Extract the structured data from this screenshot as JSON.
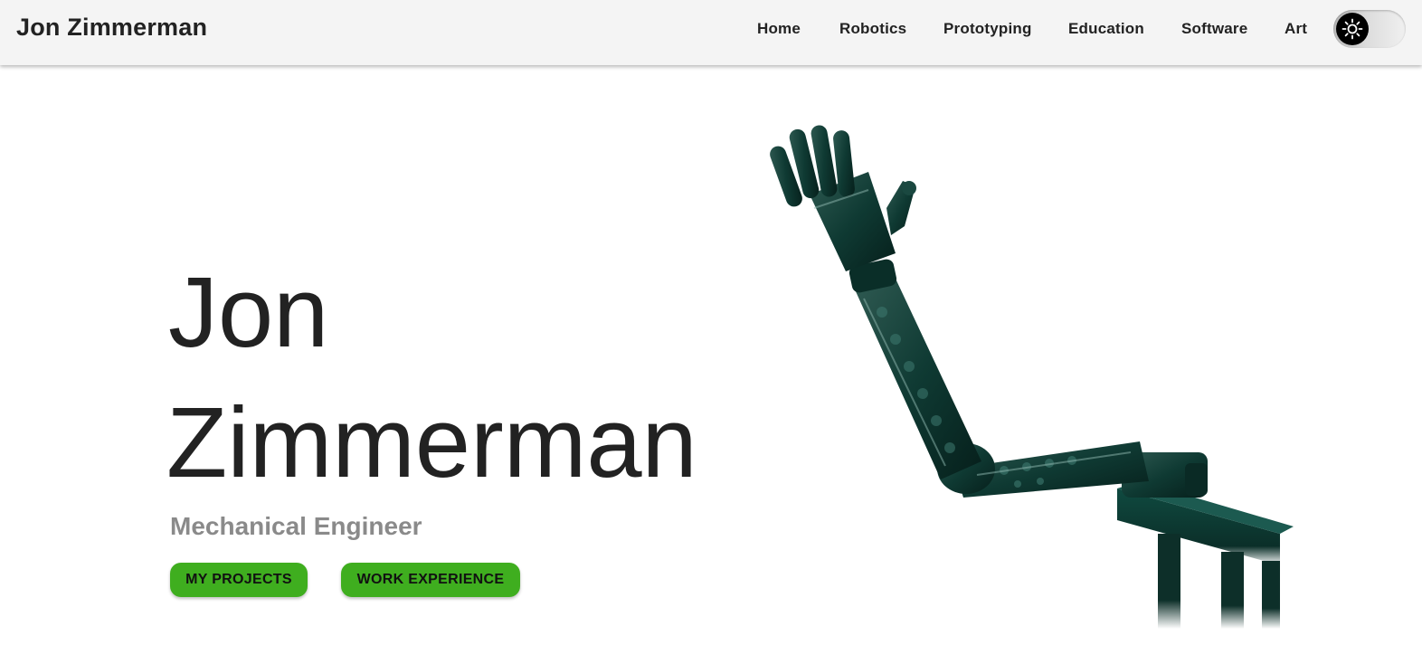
{
  "brand": "Jon Zimmerman",
  "nav": {
    "items": [
      "Home",
      "Robotics",
      "Prototyping",
      "Education",
      "Software",
      "Art"
    ],
    "theme_toggle_icon": "sun-icon"
  },
  "hero": {
    "first_name": "Jon",
    "last_name": "Zimmerman",
    "subtitle": "Mechanical Engineer",
    "buttons": [
      "MY PROJECTS",
      "WORK EXPERIENCE"
    ],
    "image_icon": "robotic-arm-icon"
  },
  "colors": {
    "accent": "#3fae1f",
    "navbar": "#f4f4f4",
    "robot": "#0e3a33",
    "subtitle": "#8a8a8a"
  }
}
